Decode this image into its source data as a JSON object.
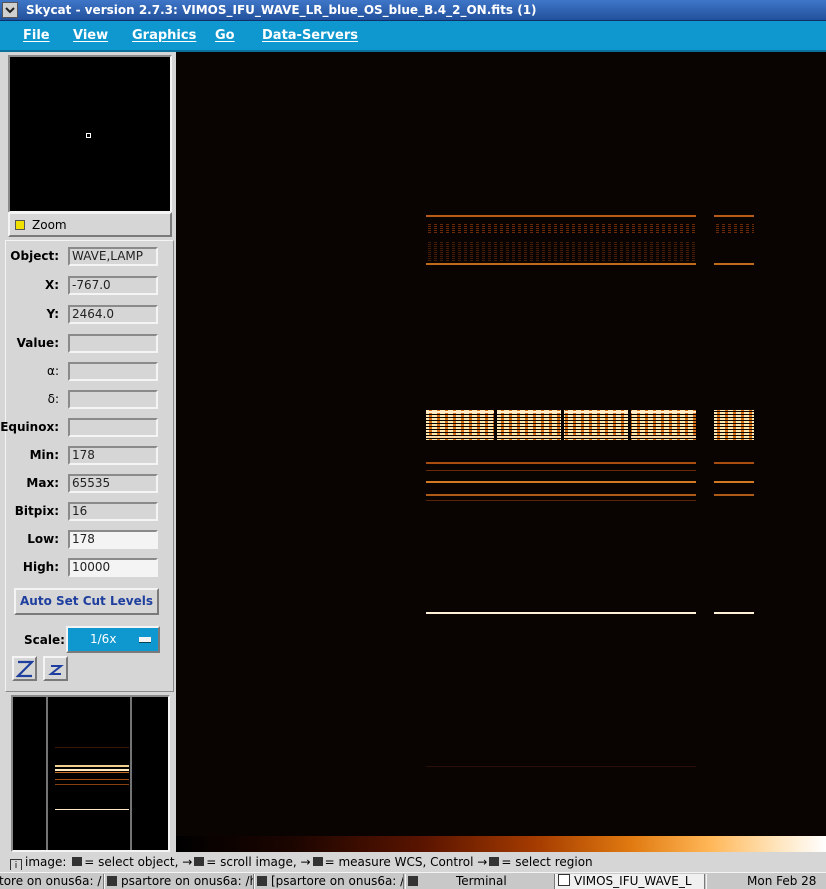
{
  "window": {
    "title": "Skycat - version 2.7.3: VIMOS_IFU_WAVE_LR_blue_OS_blue_B.4_2_ON.fits (1)"
  },
  "menu": [
    "File",
    "View",
    "Graphics",
    "Go",
    "Data-Servers"
  ],
  "zoom_toggle": {
    "label": "Zoom",
    "checked": true
  },
  "info": {
    "object_label": "Object:",
    "object": "WAVE,LAMP",
    "x_label": "X:",
    "x": "-767.0",
    "y_label": "Y:",
    "y": "2464.0",
    "value_label": "Value:",
    "value": "",
    "ra_label": "α:",
    "ra": "",
    "dec_label": "δ:",
    "dec": "",
    "equinox_label": "Equinox:",
    "equinox": "",
    "min_label": "Min:",
    "min": "178",
    "max_label": "Max:",
    "max": "65535",
    "bitpix_label": "Bitpix:",
    "bitpix": "16",
    "low_label": "Low:",
    "low": "178",
    "high_label": "High:",
    "high": "10000"
  },
  "auto_cut_label": "Auto Set Cut Levels",
  "scale": {
    "label": "Scale:",
    "value": "1/6x"
  },
  "zoom_buttons": {
    "zoom_in": "Z",
    "zoom_out": "z"
  },
  "colors": {
    "menu_bg": "#0f98cf",
    "title_bg": "#2a5fb0",
    "panel_bg": "#d6d6d6",
    "canvas_bg": "#090402",
    "spectrum_hot": "#ffe8b0",
    "spectrum_warm": "#e88a20"
  },
  "status": {
    "mode": "image:",
    "p1": "= select object,",
    "p2": "= scroll image,",
    "p3": "= measure WCS, Control",
    "p4": "= select region"
  },
  "taskbar": [
    "tore on onus6a: /",
    "psartore on onus6a: /h",
    "[psartore on onus6a: /",
    "Terminal",
    "VIMOS_IFU_WAVE_L",
    "Mon Feb 28"
  ]
}
